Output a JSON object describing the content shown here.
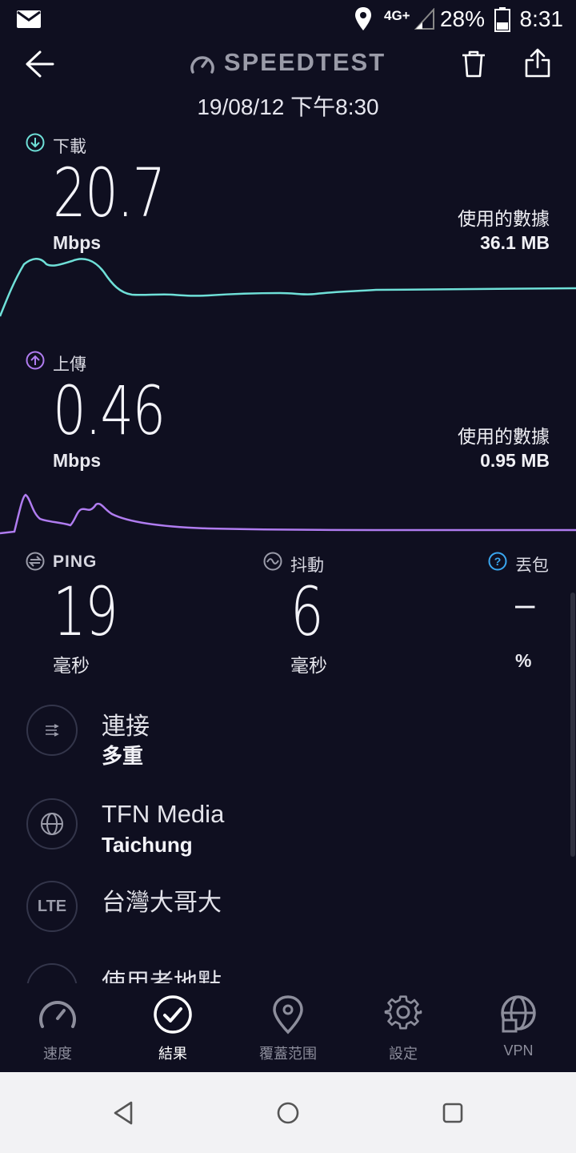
{
  "status_bar": {
    "battery": "28%",
    "time": "8:31",
    "network": "4G+"
  },
  "header": {
    "title": "SPEEDTEST",
    "date": "19/08/12 下午8:30"
  },
  "download": {
    "label": "下載",
    "value": "20.7",
    "unit": "Mbps",
    "data_label": "使用的數據",
    "data_value": "36.1 MB"
  },
  "upload": {
    "label": "上傳",
    "value": "0.46",
    "unit": "Mbps",
    "data_label": "使用的數據",
    "data_value": "0.95 MB"
  },
  "ping": {
    "label": "PING",
    "value": "19",
    "unit": "毫秒"
  },
  "jitter": {
    "label": "抖動",
    "value": "6",
    "unit": "毫秒"
  },
  "loss": {
    "label": "丟包",
    "value": "–",
    "unit": "%"
  },
  "info": {
    "connection": {
      "line1": "連接",
      "line2": "多重"
    },
    "server": {
      "line1": "TFN Media",
      "line2": "Taichung"
    },
    "provider": {
      "line1": "台灣大哥大",
      "icon_text": "LTE"
    },
    "location": {
      "line1": "使用者地點"
    }
  },
  "nav": {
    "items": [
      {
        "label": "速度"
      },
      {
        "label": "結果"
      },
      {
        "label": "覆蓋范围"
      },
      {
        "label": "設定"
      },
      {
        "label": "VPN"
      }
    ],
    "active": "結果"
  },
  "colors": {
    "download": "#6fe0d8",
    "upload": "#b07cf0",
    "loss_icon": "#3aa7f0",
    "background": "#0f0f20"
  }
}
